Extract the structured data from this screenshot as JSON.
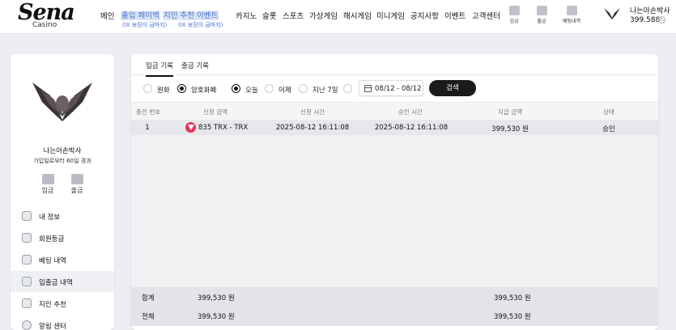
{
  "brand": {
    "name": "Sena",
    "sub": "Casino"
  },
  "nav": {
    "items": [
      "메인",
      "카지노",
      "슬롯",
      "스포츠",
      "가상게임",
      "해시게임",
      "미니게임",
      "공지사항",
      "이벤트",
      "고객센터"
    ],
    "promo1": {
      "label": "출입 페이백",
      "sub": "(ÍX 보장이 금마지)"
    },
    "promo2": {
      "label": "지인 추천 이벤트",
      "sub": "(ÍX 보장이 금마지)"
    }
  },
  "tools": {
    "deposit": "입금",
    "withdraw": "출금",
    "betting": "베팅내역"
  },
  "user": {
    "name": "나는아손박사",
    "balance": "399.588"
  },
  "sidebar": {
    "username": "나는아손박사",
    "days": "가입일로부터 60일 경과",
    "deposit": "입금",
    "withdraw": "출금",
    "menu": [
      "내 정보",
      "회원등급",
      "베팅 내역",
      "입출금 내역",
      "지인 추천",
      "알림 센터"
    ]
  },
  "tabs": [
    "입금 기록",
    "출금 기록"
  ],
  "filters": {
    "currency": [
      "원화",
      "암호화폐"
    ],
    "period": [
      "오늘",
      "어제",
      "지난 7일"
    ],
    "date_range": "08/12 - 08/12",
    "search": "검색"
  },
  "table": {
    "headers": [
      "충전 번호",
      "신청 금액",
      "신청 시간",
      "승인 시간",
      "지급 금액",
      "상태"
    ],
    "rows": [
      {
        "no": "1",
        "amount": "835 TRX - TRX",
        "requested": "2025-08-12 16:11:08",
        "approved": "2025-08-12 16:11:08",
        "paid": "399,530 원",
        "status": "승인"
      }
    ],
    "summary": [
      {
        "label": "합계",
        "request_total": "399,530 원",
        "paid_total": "399,530 원"
      },
      {
        "label": "전체",
        "request_total": "399,530 원",
        "paid_total": "399,530 원"
      }
    ]
  },
  "colors": {
    "accent": "#1b1b1b",
    "promo": "#3a6cd1",
    "coin": "#e8335e"
  }
}
